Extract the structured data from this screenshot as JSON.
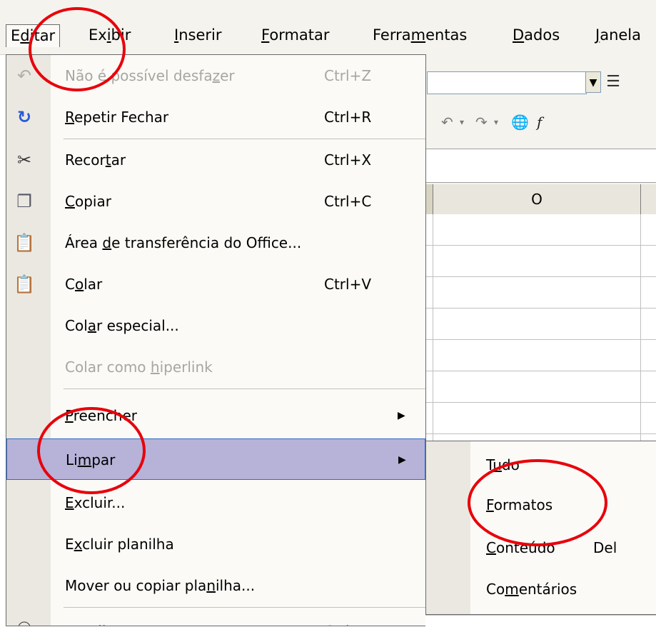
{
  "menubar": {
    "items": [
      {
        "pre": "E",
        "u": "d",
        "post": "itar"
      },
      {
        "pre": "Ex",
        "u": "i",
        "post": "bir"
      },
      {
        "pre": "",
        "u": "I",
        "post": "nserir"
      },
      {
        "pre": "",
        "u": "F",
        "post": "ormatar"
      },
      {
        "pre": "Ferra",
        "u": "m",
        "post": "entas"
      },
      {
        "pre": "",
        "u": "D",
        "post": "ados"
      },
      {
        "pre": "",
        "u": "J",
        "post": "anela"
      }
    ]
  },
  "edit_menu": {
    "items": [
      {
        "pre": "Não é possível desfa",
        "u": "z",
        "post": "er",
        "shortcut": "Ctrl+Z",
        "icon": "undo-icon"
      },
      {
        "pre": "",
        "u": "R",
        "post": "epetir Fechar",
        "shortcut": "Ctrl+R",
        "icon": "redo-icon"
      },
      {
        "pre": "Recor",
        "u": "t",
        "post": "ar",
        "shortcut": "Ctrl+X",
        "icon": "scissors-icon"
      },
      {
        "pre": "",
        "u": "C",
        "post": "opiar",
        "shortcut": "Ctrl+C",
        "icon": "copy-icon"
      },
      {
        "pre": "Área ",
        "u": "d",
        "post": "e transferência do Office...",
        "shortcut": "",
        "icon": "clipboard-office-icon"
      },
      {
        "pre": "C",
        "u": "o",
        "post": "lar",
        "shortcut": "Ctrl+V",
        "icon": "paste-icon"
      },
      {
        "pre": "Col",
        "u": "a",
        "post": "r especial...",
        "shortcut": ""
      },
      {
        "pre": "Colar como ",
        "u": "h",
        "post": "iperlink",
        "shortcut": ""
      },
      {
        "pre": "",
        "u": "P",
        "post": "reencher",
        "shortcut": ""
      },
      {
        "pre": "Li",
        "u": "m",
        "post": "par",
        "shortcut": ""
      },
      {
        "pre": "",
        "u": "E",
        "post": "xcluir...",
        "shortcut": ""
      },
      {
        "pre": "E",
        "u": "x",
        "post": "cluir planilha",
        "shortcut": ""
      },
      {
        "pre": "Mover ou copiar pla",
        "u": "n",
        "post": "ilha...",
        "shortcut": ""
      },
      {
        "pre": "Localizar...",
        "u": "",
        "post": "",
        "shortcut": "Ctrl+L",
        "icon": "binoculars-icon"
      }
    ]
  },
  "submenu": {
    "items": [
      {
        "pre": "T",
        "u": "u",
        "post": "do",
        "shortcut": ""
      },
      {
        "pre": "",
        "u": "F",
        "post": "ormatos",
        "shortcut": ""
      },
      {
        "pre": "",
        "u": "C",
        "post": "onteúdo",
        "shortcut": "Del"
      },
      {
        "pre": "Co",
        "u": "m",
        "post": "entários",
        "shortcut": ""
      }
    ]
  },
  "sheet": {
    "column_header": "O"
  },
  "colors": {
    "highlight": "#b6b2d8",
    "annotation": "#e8000b",
    "menu_bg": "#fbfaf6",
    "gutter": "#eae8e1"
  }
}
